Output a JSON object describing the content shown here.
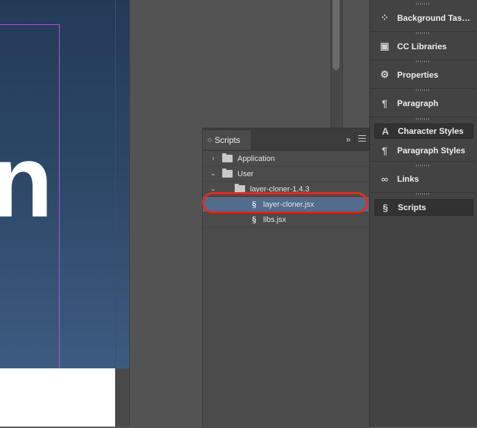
{
  "document": {
    "big_glyph": "n"
  },
  "scripts_panel": {
    "tab_label": "Scripts",
    "tab_arrows": "◇",
    "collapse_glyph": "»",
    "tree": [
      {
        "label": "Application",
        "type": "folder",
        "expanded": false
      },
      {
        "label": "User",
        "type": "folder",
        "expanded": true
      },
      {
        "label": "layer-cloner-1.4.3",
        "type": "folder",
        "expanded": true
      },
      {
        "label": "layer-cloner.jsx",
        "type": "script",
        "selected": true
      },
      {
        "label": "libs.jsx",
        "type": "script",
        "selected": false
      }
    ]
  },
  "dock": {
    "items": [
      {
        "label": "Background Tas…",
        "icon": "background-tasks-icon",
        "glyph": "⁘"
      },
      {
        "label": "CC Libraries",
        "icon": "cc-libraries-icon",
        "glyph": "▣"
      },
      {
        "label": "Properties",
        "icon": "properties-icon",
        "glyph": "⚙"
      },
      {
        "label": "Paragraph",
        "icon": "paragraph-icon",
        "glyph": "¶"
      },
      {
        "label": "Character Styles",
        "icon": "character-styles-icon",
        "glyph": "A"
      },
      {
        "label": "Paragraph Styles",
        "icon": "paragraph-styles-icon",
        "glyph": "¶"
      },
      {
        "label": "Links",
        "icon": "links-icon",
        "glyph": "∞"
      },
      {
        "label": "Scripts",
        "icon": "scripts-icon",
        "glyph": "§"
      }
    ]
  },
  "colors": {
    "selection": "#516c8c",
    "highlight_ring": "#e62b1e",
    "guide": "#b05bd6"
  }
}
